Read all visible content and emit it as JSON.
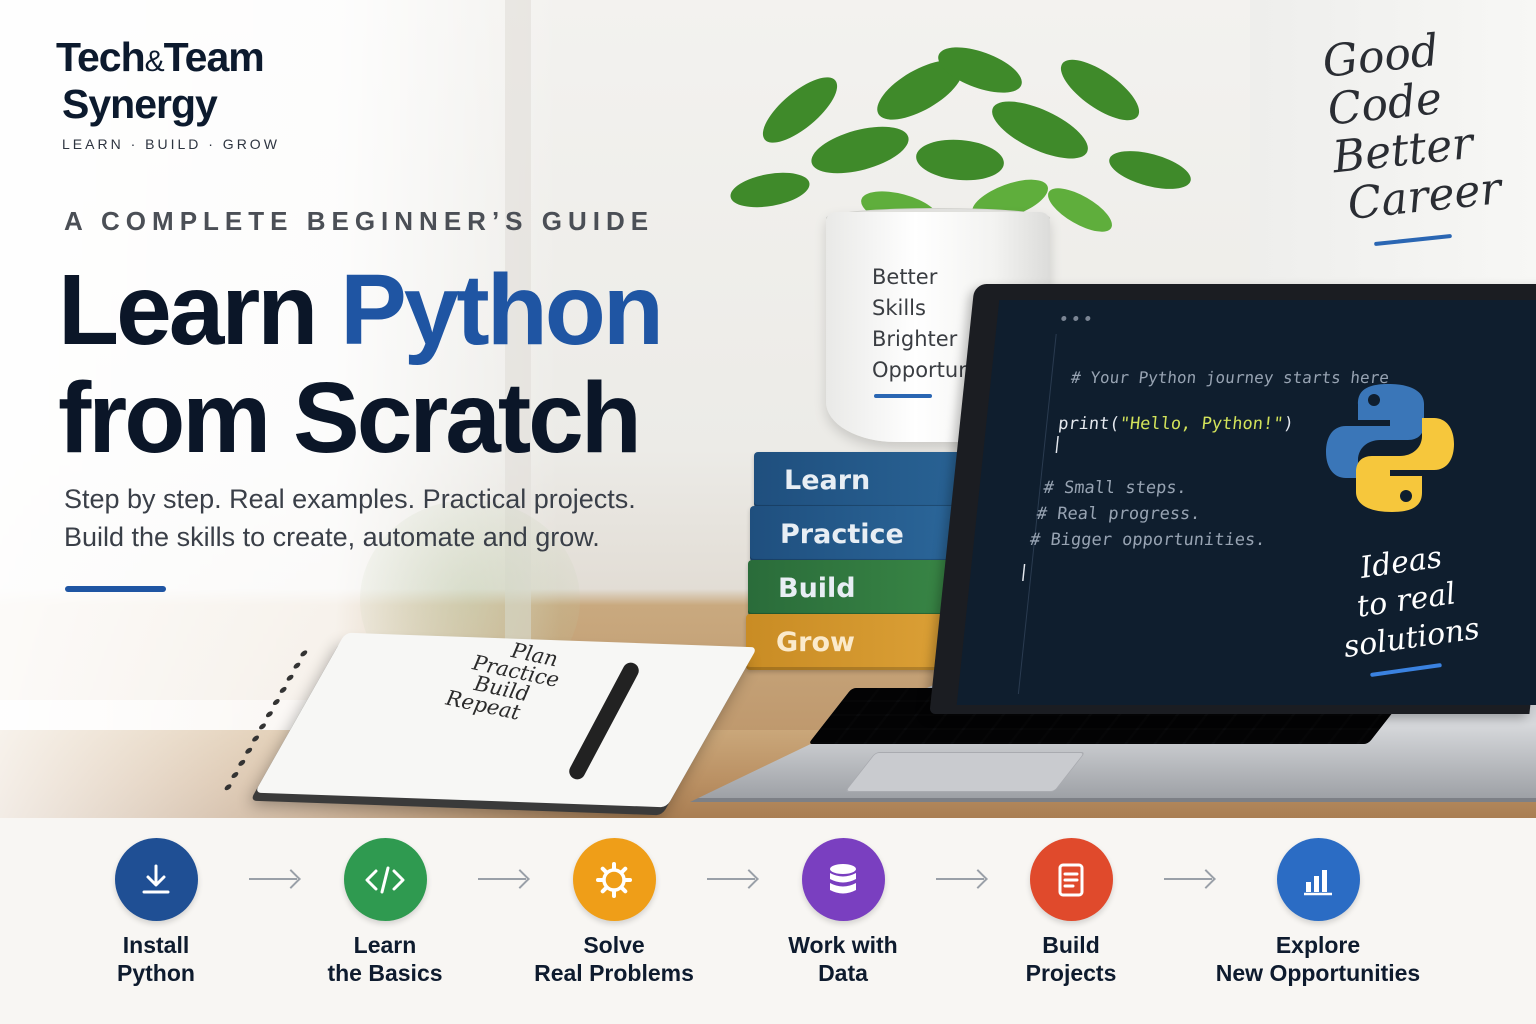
{
  "brand": {
    "name_line1": "Tech",
    "ampersand": "&",
    "name_line1_end": "Team",
    "name_line2": "Synergy",
    "tagline": "LEARN · BUILD · GROW"
  },
  "hero": {
    "kicker": "A COMPLETE BEGINNER’S GUIDE",
    "title_part1": "Learn ",
    "title_accent": "Python",
    "title_line2": "from Scratch",
    "subtitle_line1": "Step by step. Real examples. Practical projects.",
    "subtitle_line2": "Build the skills to create, automate and grow."
  },
  "pot_text": {
    "line1": "Better",
    "line2": "Skills",
    "line3": "Brighter",
    "line4": "Opportunities"
  },
  "books": [
    "Learn",
    "Practice",
    "Build",
    "Grow"
  ],
  "notebook": {
    "line1": "Plan",
    "line2": "Practice",
    "line3": "Build",
    "line4": "Repeat"
  },
  "wall_note": {
    "line1": "Good",
    "line2": "Code",
    "line3": "Better",
    "line4": "Career"
  },
  "screen": {
    "comment1": "# Your Python journey starts here",
    "code_fn": "print(",
    "code_str": "\"Hello, Python!\"",
    "code_close": ")",
    "cursor": "|",
    "comment2": "# Small steps.",
    "comment3": "# Real progress.",
    "comment4": "# Bigger opportunities.",
    "script_line1": "Ideas",
    "script_line2": "to real",
    "script_line3": "solutions"
  },
  "roadmap": [
    {
      "line1": "Install",
      "line2": "Python",
      "icon": "download-icon",
      "color": "#1f4f94"
    },
    {
      "line1": "Learn",
      "line2": "the Basics",
      "icon": "code-icon",
      "color": "#2f9a50"
    },
    {
      "line1": "Solve",
      "line2": "Real Problems",
      "icon": "gear-icon",
      "color": "#ef9e18"
    },
    {
      "line1": "Work with",
      "line2": "Data",
      "icon": "database-icon",
      "color": "#7a3fc0"
    },
    {
      "line1": "Build",
      "line2": "Projects",
      "icon": "document-icon",
      "color": "#e04a2c"
    },
    {
      "line1": "Explore",
      "line2": "New Opportunities",
      "icon": "bar-chart-icon",
      "color": "#2b6cc4"
    }
  ],
  "colors": {
    "accent": "#1f55a3",
    "title": "#0b1628"
  }
}
